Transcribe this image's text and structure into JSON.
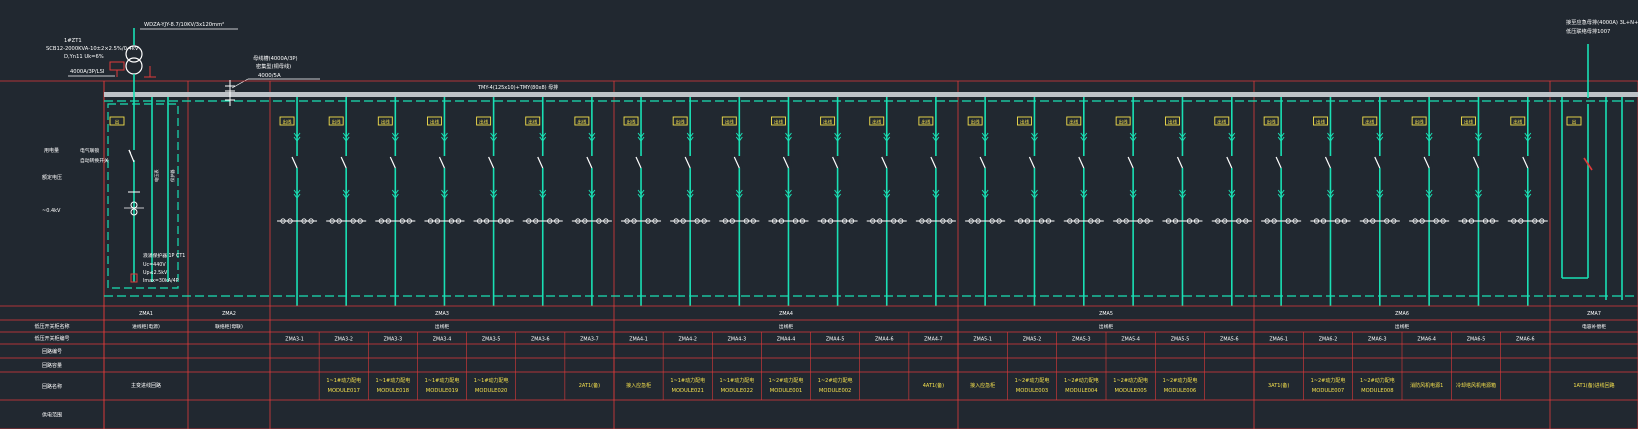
{
  "colors": {
    "background": "#212830",
    "feeder": "#19e0b4",
    "grid": "#e03a3a",
    "text": "#ffffff",
    "label_yellow": "#f4e04d",
    "busbar": "#bfc3c8",
    "symbol": "#ffffff"
  },
  "transformer": {
    "cable": "WDZA-YJY-8.7/10KV/3x120mm²",
    "name": "1#ZT1",
    "rating": "SCB12-2000KVA-10±2×2.5%/0.4kV",
    "vector": "D,Yn11  Uk=6%",
    "breaker": "4000A/3P/LSI"
  },
  "bus_duct": {
    "label1": "母线槽(4000A/3P)",
    "label2": "密集型(铜母线)",
    "rating": "4000/5A"
  },
  "busbar_spec": "TMY-4(125x10)+TMY(80x8) 母排",
  "incomer_notes": {
    "label1": "电气联锁",
    "label2": "自动转换开关",
    "meter": "电能表"
  },
  "surge": {
    "line1": "浪涌保护器  1P  CT1",
    "line2": "Uc=440V",
    "line3": "Up≤2.5kV",
    "line4": "Imax=30kA/4P"
  },
  "right_note": {
    "line1": "接至应急母排(4000A) 3L+N+PE",
    "line2": "低压联络母排1007"
  },
  "left_labels": {
    "l1": "用电量",
    "l2": "额定电压",
    "l3": "~0.4kV"
  },
  "row_headers": [
    "",
    "低压开关柜名称",
    "低压开关柜编号",
    "回路编号",
    "回路容量",
    "回路名称",
    "供电范围"
  ],
  "cabinets": [
    {
      "id": "ZMA1",
      "name": "进线柜(电源)"
    },
    {
      "id": "ZMA2",
      "name": "联络柜(母联)"
    },
    {
      "id": "ZMA3",
      "name": "出线柜"
    },
    {
      "id": "ZMA4",
      "name": "出线柜"
    },
    {
      "id": "ZMA5",
      "name": "出线柜"
    },
    {
      "id": "ZMA6",
      "name": "出线柜"
    },
    {
      "id": "ZMA7",
      "name": "电容补偿柜"
    }
  ],
  "incomer_circuit": "主变进线回路",
  "feeders": [
    {
      "tag": "出线",
      "circuit": "ZMA3-1",
      "name1": "",
      "name2": ""
    },
    {
      "tag": "出线",
      "circuit": "ZMA3-2",
      "name1": "1~1#动力配电",
      "name2": "MODULE017"
    },
    {
      "tag": "出线",
      "circuit": "ZMA3-3",
      "name1": "1~1#动力配电",
      "name2": "MODULE018"
    },
    {
      "tag": "出线",
      "circuit": "ZMA3-4",
      "name1": "1~1#动力配电",
      "name2": "MODULE019"
    },
    {
      "tag": "出线",
      "circuit": "ZMA3-5",
      "name1": "1~1#动力配电",
      "name2": "MODULE020"
    },
    {
      "tag": "出线",
      "circuit": "ZMA3-6",
      "name1": "",
      "name2": ""
    },
    {
      "tag": "出线",
      "circuit": "ZMA3-7",
      "name1": "2AT1(备)",
      "name2": ""
    },
    {
      "tag": "出线",
      "circuit": "ZMA4-1",
      "name1": "接入应急柜",
      "name2": ""
    },
    {
      "tag": "出线",
      "circuit": "ZMA4-2",
      "name1": "1~1#动力配电",
      "name2": "MODULE021"
    },
    {
      "tag": "出线",
      "circuit": "ZMA4-3",
      "name1": "1~1#动力配电",
      "name2": "MODULE022"
    },
    {
      "tag": "出线",
      "circuit": "ZMA4-4",
      "name1": "1~2#动力配电",
      "name2": "MODULE001"
    },
    {
      "tag": "出线",
      "circuit": "ZMA4-5",
      "name1": "1~2#动力配电",
      "name2": "MODULE002"
    },
    {
      "tag": "出线",
      "circuit": "ZMA4-6",
      "name1": "",
      "name2": ""
    },
    {
      "tag": "出线",
      "circuit": "ZMA4-7",
      "name1": "4AT1(备)",
      "name2": ""
    },
    {
      "tag": "出线",
      "circuit": "ZMA5-1",
      "name1": "接入应急柜",
      "name2": ""
    },
    {
      "tag": "出线",
      "circuit": "ZMA5-2",
      "name1": "1~2#动力配电",
      "name2": "MODULE003"
    },
    {
      "tag": "出线",
      "circuit": "ZMA5-3",
      "name1": "1~2#动力配电",
      "name2": "MODULE004"
    },
    {
      "tag": "出线",
      "circuit": "ZMA5-4",
      "name1": "1~2#动力配电",
      "name2": "MODULE005"
    },
    {
      "tag": "出线",
      "circuit": "ZMA5-5",
      "name1": "1~2#动力配电",
      "name2": "MODULE006"
    },
    {
      "tag": "出线",
      "circuit": "ZMA5-6",
      "name1": "",
      "name2": ""
    },
    {
      "tag": "出线",
      "circuit": "ZMA6-1",
      "name1": "3AT1(备)",
      "name2": ""
    },
    {
      "tag": "出线",
      "circuit": "ZMA6-2",
      "name1": "1~2#动力配电",
      "name2": "MODULE007"
    },
    {
      "tag": "出线",
      "circuit": "ZMA6-3",
      "name1": "1~2#动力配电",
      "name2": "MODULE008"
    },
    {
      "tag": "出线",
      "circuit": "ZMA6-4",
      "name1": "消防风机电源1",
      "name2": ""
    },
    {
      "tag": "出线",
      "circuit": "ZMA6-5",
      "name1": "冷却塔风机电源箱",
      "name2": ""
    },
    {
      "tag": "出线",
      "circuit": "ZMA6-6",
      "name1": "",
      "name2": ""
    }
  ],
  "last_cabinet": {
    "tag": "出线",
    "circuit": "",
    "name1": "1AT1(备)进线回路",
    "name2": ""
  }
}
